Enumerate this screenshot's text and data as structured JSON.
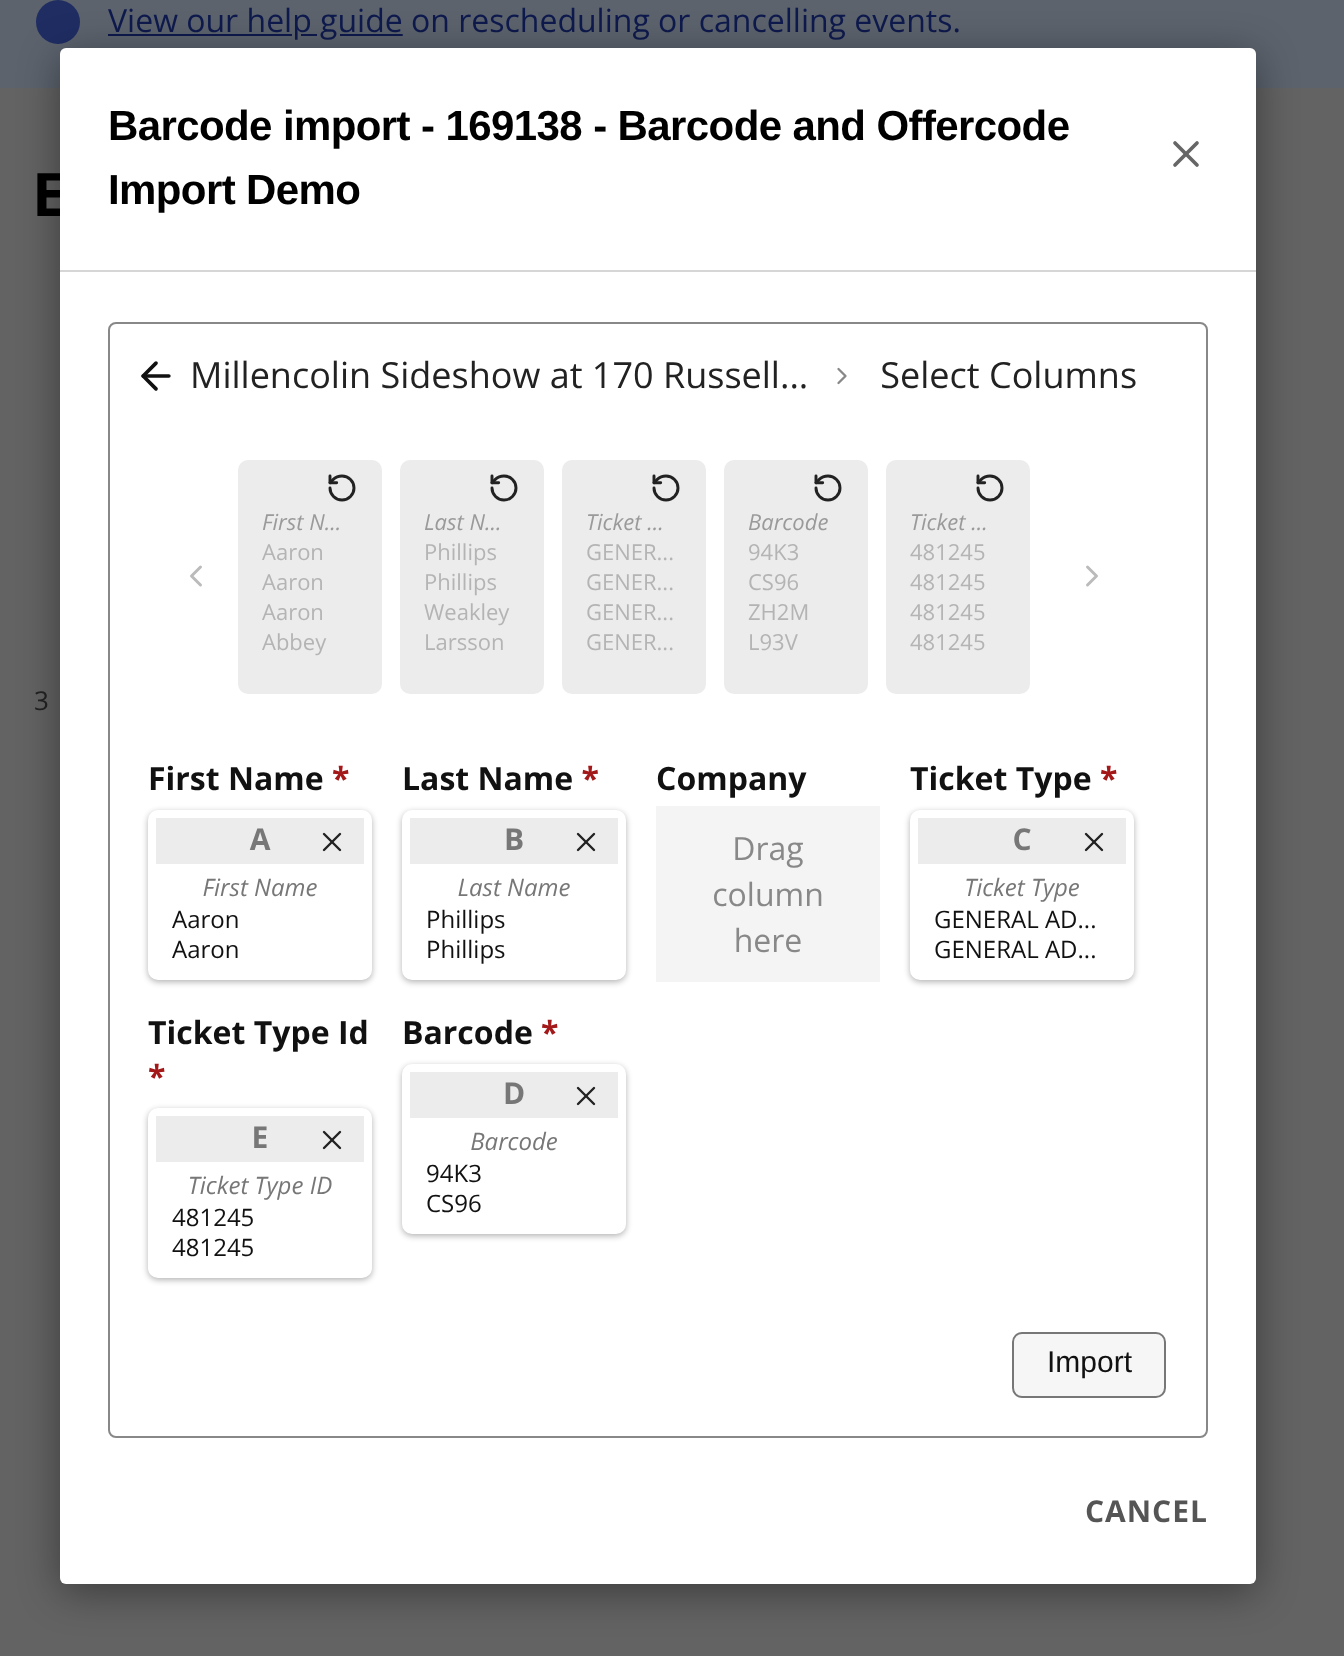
{
  "backdrop": {
    "help_link": "View our help guide",
    "help_text": "on rescheduling or cancelling events.",
    "heading": "E",
    "section_count": "3"
  },
  "required_mark": "*",
  "dialog": {
    "title": "Barcode import - 169138 - Barcode and Offercode Import Demo"
  },
  "breadcrumb": {
    "event": "Millencolin Sideshow at 170 Russell...",
    "step": "Select Columns"
  },
  "source_columns": [
    {
      "header": "First N...",
      "values": [
        "Aaron",
        "Aaron",
        "Aaron",
        "Abbey"
      ]
    },
    {
      "header": "Last N...",
      "values": [
        "Phillips",
        "Phillips",
        "Weakley",
        "Larsson"
      ]
    },
    {
      "header": "Ticket ...",
      "values": [
        "GENER...",
        "GENER...",
        "GENER...",
        "GENER..."
      ]
    },
    {
      "header": "Barcode",
      "values": [
        "94K3",
        "CS96",
        "ZH2M",
        "L93V"
      ]
    },
    {
      "header": "Ticket ...",
      "values": [
        "481245",
        "481245",
        "481245",
        "481245"
      ]
    }
  ],
  "targets": [
    {
      "label": "First Name",
      "required": true,
      "kind": "mapped",
      "letter": "A",
      "header": "First Name",
      "values": [
        "Aaron",
        "Aaron"
      ]
    },
    {
      "label": "Last Name",
      "required": true,
      "kind": "mapped",
      "letter": "B",
      "header": "Last Name",
      "values": [
        "Phillips",
        "Phillips"
      ]
    },
    {
      "label": "Company",
      "required": false,
      "kind": "empty",
      "empty_text": "Drag column here"
    },
    {
      "label": "Ticket Type",
      "required": true,
      "kind": "mapped",
      "letter": "C",
      "header": "Ticket Type",
      "values": [
        "GENERAL AD...",
        "GENERAL AD..."
      ]
    },
    {
      "label": "Ticket Type Id",
      "required": true,
      "kind": "mapped",
      "letter": "E",
      "header": "Ticket Type ID",
      "values": [
        "481245",
        "481245"
      ]
    },
    {
      "label": "Barcode",
      "required": true,
      "kind": "mapped",
      "letter": "D",
      "header": "Barcode",
      "values": [
        "94K3",
        "CS96"
      ]
    }
  ],
  "buttons": {
    "import": "Import",
    "cancel": "CANCEL"
  }
}
